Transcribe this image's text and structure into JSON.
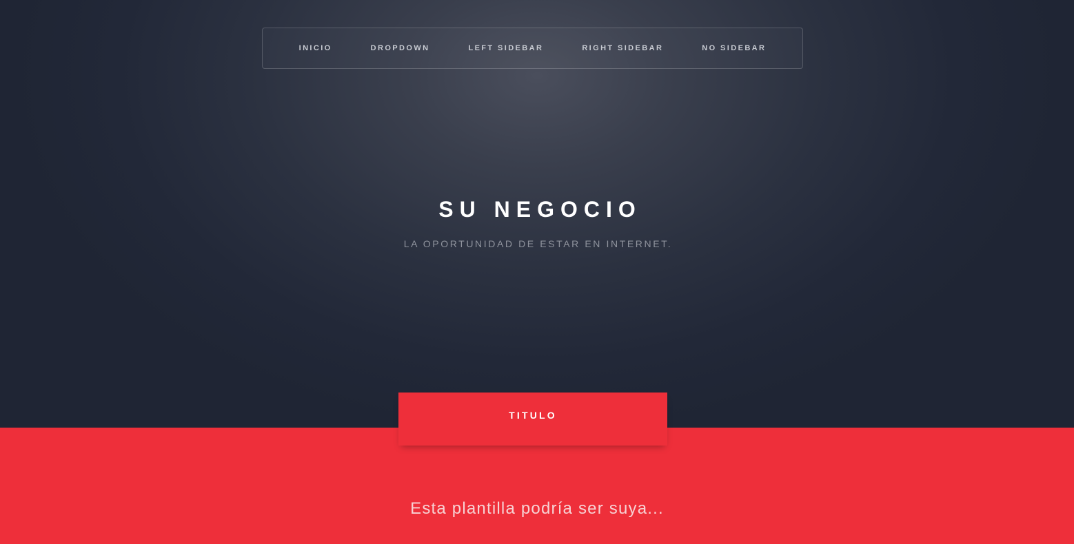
{
  "nav": {
    "items": [
      {
        "label": "INICIO"
      },
      {
        "label": "DROPDOWN"
      },
      {
        "label": "LEFT SIDEBAR"
      },
      {
        "label": "RIGHT SIDEBAR"
      },
      {
        "label": "NO SIDEBAR"
      }
    ]
  },
  "hero": {
    "title": "SU NEGOCIO",
    "subtitle": "LA OPORTUNIDAD DE ESTAR EN INTERNET."
  },
  "section": {
    "tab_label": "TITULO",
    "text": "Esta plantilla podría ser suya..."
  },
  "colors": {
    "hero_background": "#2b3140",
    "accent": "#ee2f3a",
    "nav_text": "#c9ccd3",
    "subtitle_text": "#8f939d"
  }
}
